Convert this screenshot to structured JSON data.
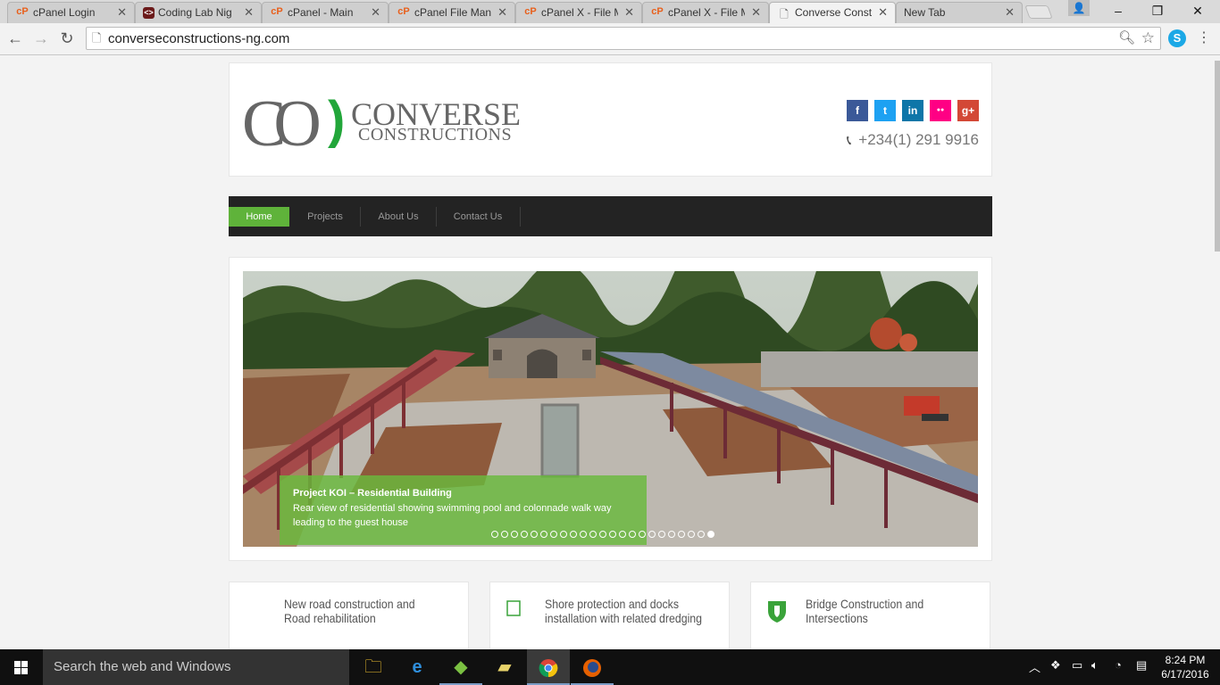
{
  "browser": {
    "tabs": [
      {
        "title": "cPanel Login",
        "icon": "cpanel-icon"
      },
      {
        "title": "Coding Lab Nig",
        "icon": "codinglab-icon"
      },
      {
        "title": "cPanel - Main",
        "icon": "cpanel-icon"
      },
      {
        "title": "cPanel File Mana",
        "icon": "cpanel-icon"
      },
      {
        "title": "cPanel X - File M",
        "icon": "cpanel-icon"
      },
      {
        "title": "cPanel X - File M",
        "icon": "cpanel-icon"
      },
      {
        "title": "Converse Constr",
        "icon": "page-icon",
        "active": true
      },
      {
        "title": "New Tab",
        "icon": "none"
      }
    ],
    "close_glyph": "✕",
    "url": "converseconstructions-ng.com"
  },
  "site": {
    "logo": {
      "mark": "CO",
      "wordmark_line1": "CONVERSE",
      "wordmark_line2": "CONSTRUCTIONS",
      "accent_color": "#22a63a"
    },
    "social": [
      {
        "name": "facebook",
        "glyph": "f",
        "color": "#3b5998"
      },
      {
        "name": "twitter",
        "glyph": "t",
        "color": "#1da1f2"
      },
      {
        "name": "linkedin",
        "glyph": "in",
        "color": "#0e76a8"
      },
      {
        "name": "flickr",
        "glyph": "●●",
        "color": "#ff0084"
      },
      {
        "name": "google-plus",
        "glyph": "g+",
        "color": "#d34836"
      }
    ],
    "phone": "+234(1) 291 9916",
    "nav": [
      "Home",
      "Projects",
      "About Us",
      "Contact Us"
    ],
    "nav_active_color": "#5fb33a",
    "slider": {
      "caption_title": "Project KOI – Residential Building",
      "caption_text": "Rear view of residential showing swimming pool and colonnade walk way leading to the guest house",
      "dot_count": 23,
      "active_dot": 22
    },
    "features": [
      {
        "text": "New road construction and Road rehabilitation",
        "icon": "none"
      },
      {
        "text": "Shore protection and docks installation with related dredging",
        "icon": "square-outline-icon"
      },
      {
        "text": "Bridge Construction and Intersections",
        "icon": "shield-icon"
      }
    ]
  },
  "taskbar": {
    "search_placeholder": "Search the web and Windows",
    "apps": [
      "file-explorer-icon",
      "edge-icon",
      "bluestacks-icon",
      "folder-app-icon",
      "chrome-icon",
      "firefox-icon"
    ],
    "time": "8:24 PM",
    "date": "6/17/2016"
  }
}
